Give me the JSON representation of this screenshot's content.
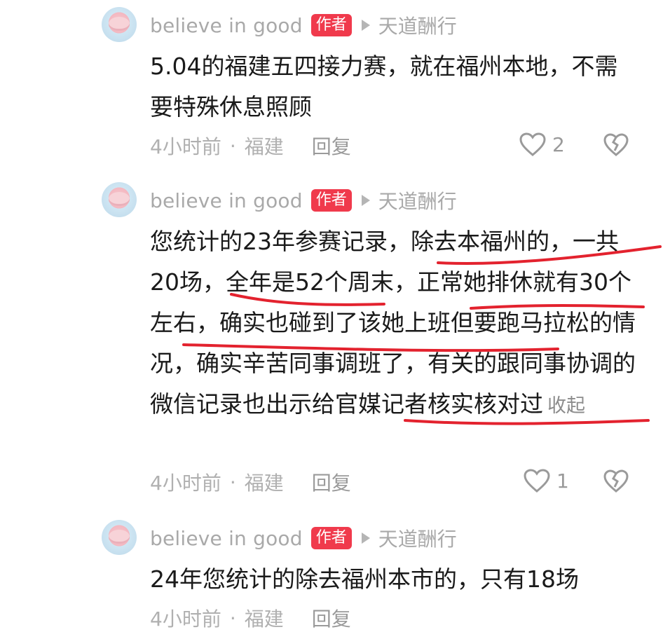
{
  "comments": [
    {
      "username": "believe in good",
      "badge": "作者",
      "reply_to": "天道酬行",
      "text": "5.04的福建五四接力赛，就在福州本地，不需要特殊休息照顾",
      "time": "4小时前",
      "location": "福建",
      "reply_label": "回复",
      "likes": "2"
    },
    {
      "username": "believe in good",
      "badge": "作者",
      "reply_to": "天道酬行",
      "text": "您统计的23年参赛记录，除去本福州的，一共20场，全年是52个周末，正常她排休就有30个左右，确实也碰到了该她上班但要跑马拉松的情况，确实辛苦同事调班了，有关的跟同事协调的微信记录也出示给官媒记者核实核对过",
      "collapse": "收起",
      "time": "4小时前",
      "location": "福建",
      "reply_label": "回复",
      "likes": "1"
    },
    {
      "username": "believe in good",
      "badge": "作者",
      "reply_to": "天道酬行",
      "text": "24年您统计的除去福州本市的，只有18场",
      "time": "4小时前",
      "location": "福建",
      "reply_label": "回复"
    }
  ],
  "meta_separator": "·",
  "colors": {
    "badge": "#f03a4c",
    "annotation": "#e3222e",
    "muted": "#a9a9a9"
  },
  "icons": {
    "like": "heart-outline-icon",
    "dislike": "broken-heart-icon",
    "reply": "triangle-arrow-icon"
  }
}
